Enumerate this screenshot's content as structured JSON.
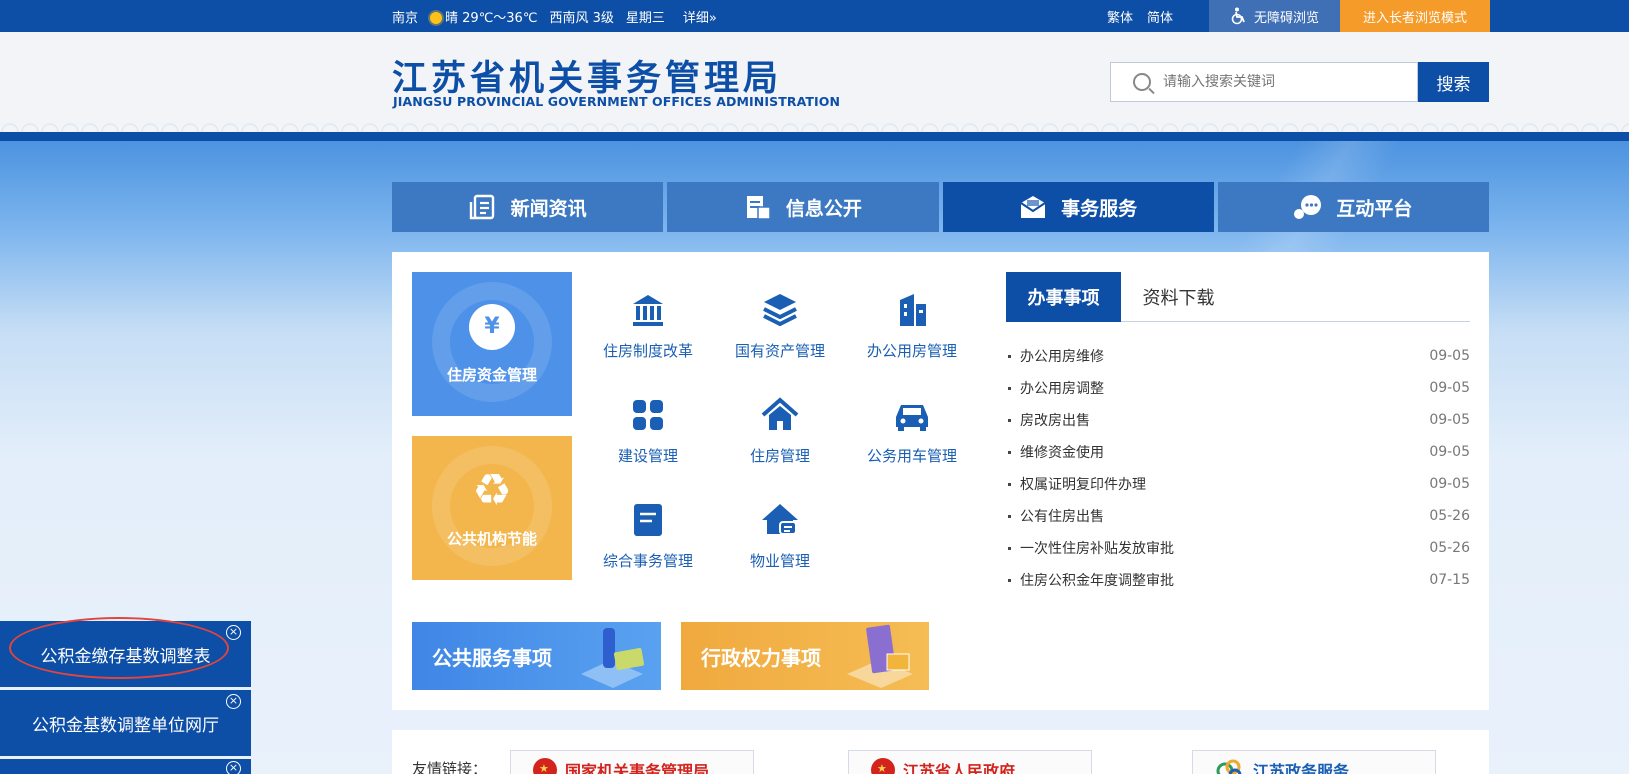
{
  "topbar": {
    "city": "南京",
    "weather": "晴 29℃～36℃",
    "wind": "西南风 3级",
    "weekday": "星期三",
    "detail": "详细»",
    "trad": "繁体",
    "simp": "简体",
    "accessible": "无障碍浏览",
    "elder": "进入长者浏览模式"
  },
  "header": {
    "title_cn": "江苏省机关事务管理局",
    "title_en": "JIANGSU PROVINCIAL GOVERNMENT OFFICES ADMINISTRATION",
    "search_placeholder": "请输入搜索关键词",
    "search_button": "搜索"
  },
  "nav": [
    {
      "label": "新闻资讯",
      "icon": "news-icon"
    },
    {
      "label": "信息公开",
      "icon": "info-icon"
    },
    {
      "label": "事务服务",
      "icon": "service-icon",
      "active": true
    },
    {
      "label": "互动平台",
      "icon": "chat-icon"
    }
  ],
  "tiles": {
    "housing_fund": "住房资金管理",
    "energy": "公共机构节能"
  },
  "services": [
    {
      "label": "住房制度改革",
      "icon": "bank-icon"
    },
    {
      "label": "国有资产管理",
      "icon": "layers-icon"
    },
    {
      "label": "办公用房管理",
      "icon": "building-icon"
    },
    {
      "label": "建设管理",
      "icon": "grid-icon"
    },
    {
      "label": "住房管理",
      "icon": "home-icon"
    },
    {
      "label": "公务用车管理",
      "icon": "car-icon"
    },
    {
      "label": "综合事务管理",
      "icon": "document-icon"
    },
    {
      "label": "物业管理",
      "icon": "property-icon"
    }
  ],
  "list_tabs": [
    "办事事项",
    "资料下载"
  ],
  "items": [
    {
      "title": "办公用房维修",
      "date": "09-05"
    },
    {
      "title": "办公用房调整",
      "date": "09-05"
    },
    {
      "title": "房改房出售",
      "date": "09-05"
    },
    {
      "title": "维修资金使用",
      "date": "09-05"
    },
    {
      "title": "权属证明复印件办理",
      "date": "09-05"
    },
    {
      "title": "公有住房出售",
      "date": "05-26"
    },
    {
      "title": "一次性住房补贴发放审批",
      "date": "05-26"
    },
    {
      "title": "住房公积金年度调整审批",
      "date": "07-15"
    }
  ],
  "bottom_buttons": {
    "public": "公共服务事项",
    "admin": "行政权力事项"
  },
  "friends": {
    "title": "友情链接：",
    "links": [
      "国家机关事务管理局",
      "江苏省人民政府",
      "江苏政务服务"
    ]
  },
  "float_panel": [
    "公积金缴存基数调整表",
    "公积金基数调整单位网厅"
  ],
  "colors": {
    "primary": "#0d4ea6",
    "nav": "#3d79c3",
    "accent_orange": "#f59b2a",
    "tile_blue": "#4d91e8",
    "tile_yellow": "#f3b64d",
    "highlight_ring": "#e2453f"
  }
}
